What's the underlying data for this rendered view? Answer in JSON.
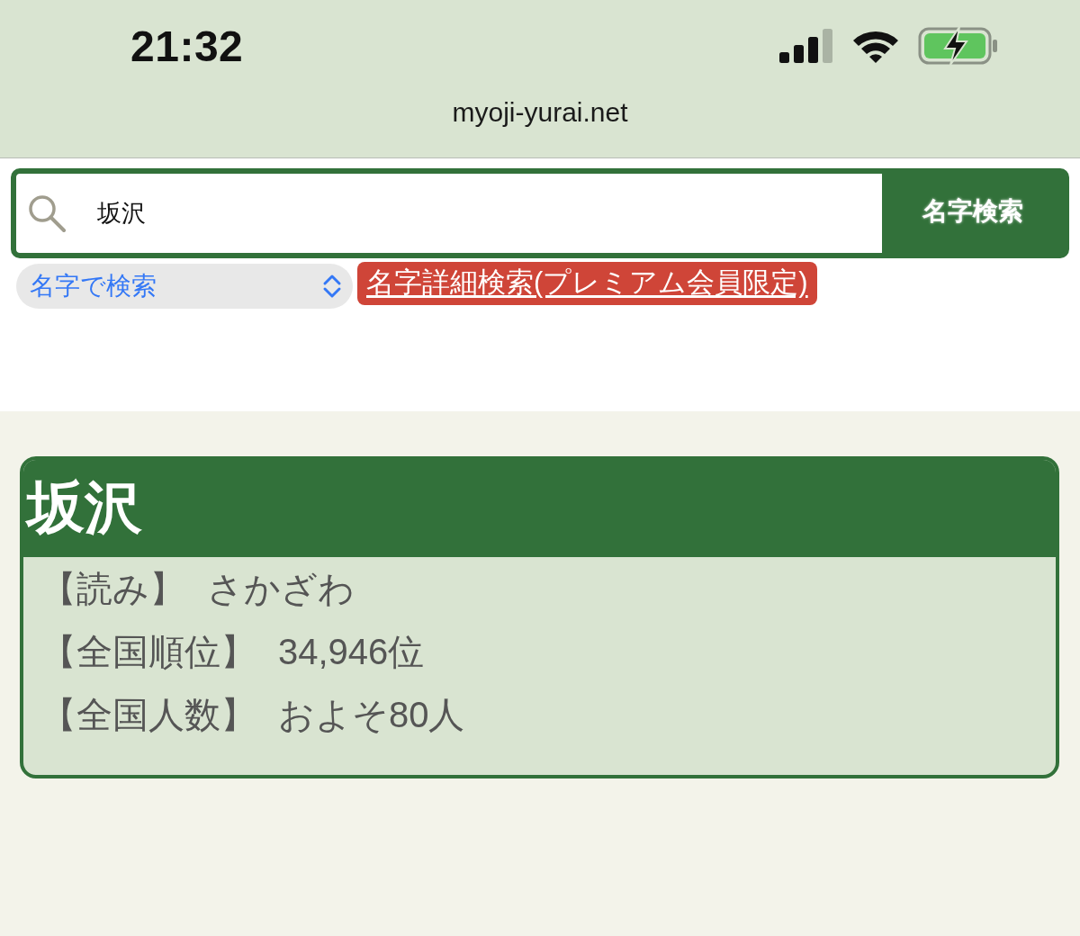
{
  "status_bar": {
    "time": "21:32"
  },
  "address_bar": {
    "url": "myoji-yurai.net"
  },
  "search": {
    "value": "坂沢",
    "button": "名字検索"
  },
  "search_mode": {
    "value": "名字で検索"
  },
  "premium_link": {
    "label": "名字詳細検索(プレミアム会員限定)"
  },
  "result_card": {
    "title": "坂沢",
    "rows": [
      {
        "label": "【読み】",
        "value": "さかざわ"
      },
      {
        "label": "【全国順位】",
        "value": "34,946位"
      },
      {
        "label": "【全国人数】",
        "value": "およそ80人"
      }
    ]
  }
}
